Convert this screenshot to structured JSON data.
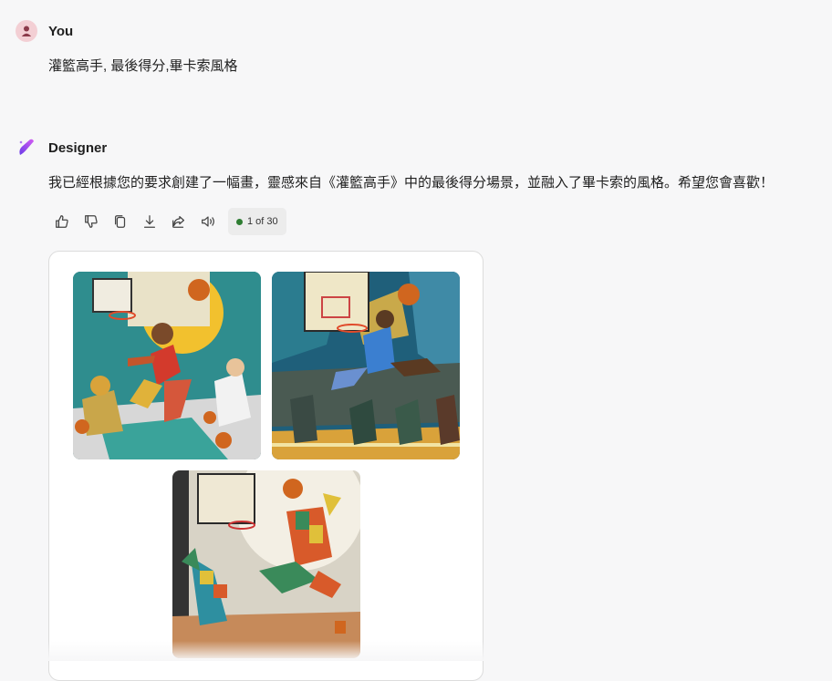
{
  "user_message": {
    "sender": "You",
    "text": "灌籃高手, 最後得分,畢卡索風格"
  },
  "assistant_message": {
    "sender": "Designer",
    "text": "我已經根據您的要求創建了一幅畫，靈感來自《灌籃高手》中的最後得分場景，並融入了畢卡索的風格。希望您會喜歡！"
  },
  "actions": {
    "icons": [
      "thumbs-up-icon",
      "thumbs-down-icon",
      "copy-icon",
      "download-icon",
      "share-icon",
      "read-aloud-icon"
    ],
    "counter": "1 of 30",
    "counter_color": "#2e7d32"
  },
  "images": [
    {
      "name": "image-1",
      "subject": "cubist dunker in red jersey over seated figures"
    },
    {
      "name": "image-2",
      "subject": "cubist dunker in blue jersey 23 over crowd"
    },
    {
      "name": "image-3",
      "subject": "patchwork harlequin figures dunking"
    }
  ]
}
